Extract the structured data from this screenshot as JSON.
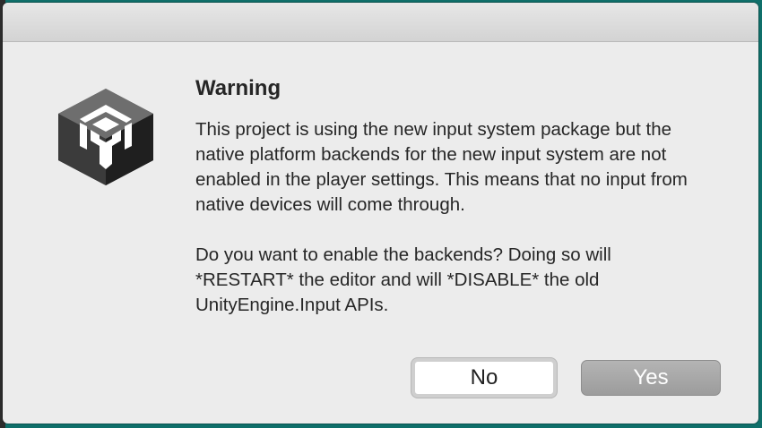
{
  "dialog": {
    "title": "Warning",
    "message_paragraph_1": "This project is using the new input system package but the native platform backends for the new input system are not enabled in the player settings. This means that no input from native devices will come through.",
    "message_paragraph_2": "Do you want to enable the backends? Doing so will *RESTART* the editor and will *DISABLE* the old UnityEngine.Input APIs.",
    "icon": "unity-logo-icon",
    "buttons": {
      "no_label": "No",
      "yes_label": "Yes"
    }
  },
  "colors": {
    "desktop": "#0f6f6a",
    "dialog_bg": "#ececec",
    "yes_button": "#a8a8a8"
  }
}
